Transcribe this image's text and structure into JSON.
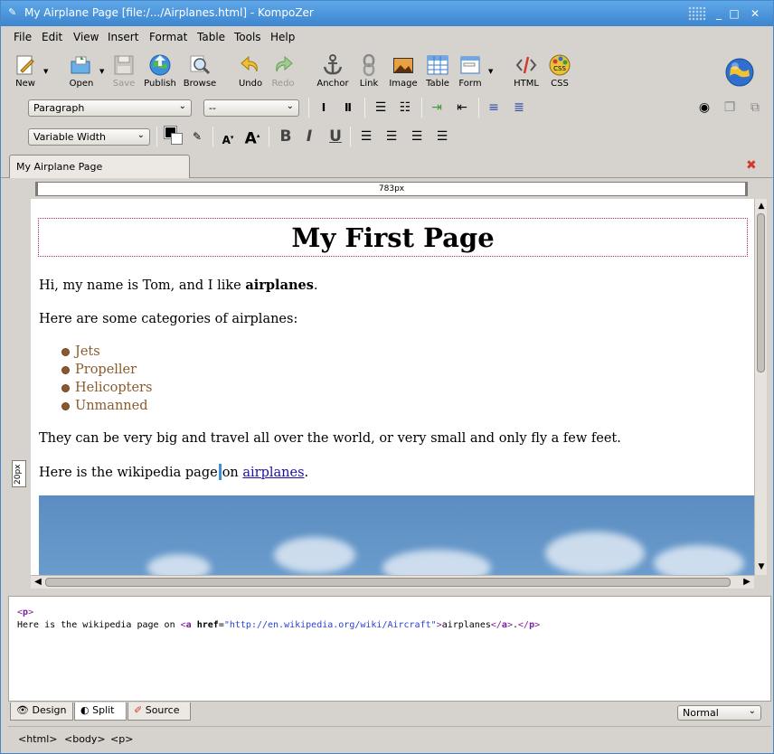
{
  "window": {
    "title": "My Airplane Page [file:/.../Airplanes.html] - KompoZer",
    "app_icon": "kompozer-icon",
    "minimize": "_",
    "maximize": "□",
    "close": "✕"
  },
  "menu": [
    "File",
    "Edit",
    "View",
    "Insert",
    "Format",
    "Table",
    "Tools",
    "Help"
  ],
  "toolbar": {
    "new": "New",
    "open": "Open",
    "save": "Save",
    "publish": "Publish",
    "browse": "Browse",
    "undo": "Undo",
    "redo": "Redo",
    "anchor": "Anchor",
    "link": "Link",
    "image": "Image",
    "table": "Table",
    "form": "Form",
    "html": "HTML",
    "css": "CSS"
  },
  "format": {
    "paragraph_style": "Paragraph",
    "font": "--",
    "width_mode": "Variable Width",
    "bold": "B",
    "italic": "I",
    "underline": "U"
  },
  "tab": {
    "label": "My Airplane Page"
  },
  "ruler": {
    "width_label": "783px",
    "height_label": "20px"
  },
  "document": {
    "heading": "My First Page",
    "intro_prefix": "Hi, my name is Tom, and I like ",
    "intro_bold": "airplanes",
    "intro_suffix": ".",
    "categories_intro": "Here are some categories of airplanes:",
    "categories": [
      "Jets",
      "Propeller",
      "Helicopters",
      "Unmanned"
    ],
    "size_sentence": "They can be very big and travel all over the world, or very small and only fly a few feet.",
    "wiki_prefix": "Here is the wikipedia page",
    "wiki_mid": "on ",
    "wiki_link": "airplanes",
    "wiki_suffix": "."
  },
  "source_pane": {
    "line1_open": "<",
    "line1_tag": "p",
    "line1_close": ">",
    "line2_text": "Here is the wikipedia page on ",
    "line2_lt": "<",
    "line2_a": "a",
    "line2_sp": " ",
    "line2_attr": "href",
    "line2_eq": "=",
    "line2_val": "\"http://en.wikipedia.org/wiki/Aircraft\"",
    "line2_gt": ">",
    "line2_link_text": "airplanes",
    "line2_close_a_lt": "</",
    "line2_close_a": "a",
    "line2_close_a_gt": ">",
    "line2_dot": ".",
    "line2_close_p_lt": "</",
    "line2_close_p": "p",
    "line2_close_p_gt": ">"
  },
  "modes": {
    "design": "Design",
    "split": "Split",
    "source": "Source"
  },
  "view_mode": "Normal",
  "status_path": [
    "<html>",
    "<body>",
    "<p>"
  ]
}
